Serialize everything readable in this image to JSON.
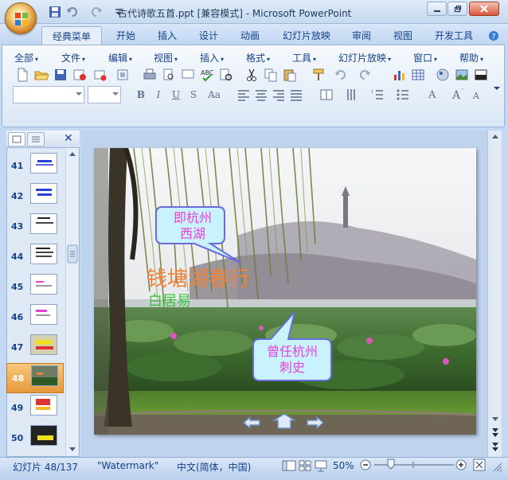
{
  "window": {
    "title": "古代诗歌五首.ppt [兼容模式] - Microsoft PowerPoint",
    "minimize_icon": "minimize-icon",
    "restore_icon": "restore-icon",
    "close_icon": "close-icon"
  },
  "ribbon_tabs": [
    {
      "label": "经典菜单"
    },
    {
      "label": "开始"
    },
    {
      "label": "插入"
    },
    {
      "label": "设计"
    },
    {
      "label": "动画"
    },
    {
      "label": "幻灯片放映"
    },
    {
      "label": "审阅"
    },
    {
      "label": "视图"
    },
    {
      "label": "开发工具"
    }
  ],
  "menu": [
    {
      "label": "全部"
    },
    {
      "label": "文件"
    },
    {
      "label": "编辑"
    },
    {
      "label": "视图"
    },
    {
      "label": "插入"
    },
    {
      "label": "格式"
    },
    {
      "label": "工具"
    },
    {
      "label": "幻灯片放映"
    },
    {
      "label": "窗口"
    },
    {
      "label": "帮助"
    }
  ],
  "format": {
    "bold": "B",
    "italic": "I",
    "underline": "U",
    "strike": "S",
    "case": "Aa"
  },
  "slides": [
    {
      "num": "41"
    },
    {
      "num": "42"
    },
    {
      "num": "43"
    },
    {
      "num": "44"
    },
    {
      "num": "45"
    },
    {
      "num": "46"
    },
    {
      "num": "47"
    },
    {
      "num": "48"
    },
    {
      "num": "49"
    },
    {
      "num": "50"
    }
  ],
  "active_slide": "48",
  "slide": {
    "callout_top": "即杭州\n西湖",
    "callout_top_l1": "即杭州",
    "callout_top_l2": "西湖",
    "poem_title": "钱塘湖春行",
    "author": "白居易",
    "callout_bottom_l1": "曾任杭州",
    "callout_bottom_l2": "刺史"
  },
  "pane": {
    "close": "✕"
  },
  "status": {
    "slide_info": "幻灯片 48/137",
    "theme": "\"Watermark\"",
    "language": "中文(简体，中国)",
    "zoom": "50%"
  },
  "colors": {
    "accent": "#15428b",
    "active_slide": "#e69a3b",
    "callout_fill": "#c9f2ff",
    "callout_text": "#e83fd6",
    "poem_title": "#f0823a",
    "author": "#3ec43e"
  }
}
